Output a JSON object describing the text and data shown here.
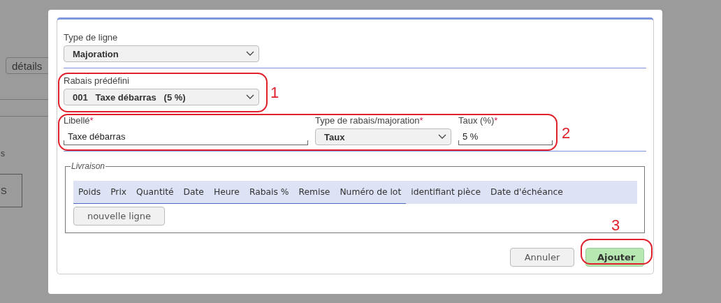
{
  "background": {
    "button": "détails",
    "text_1": "s",
    "text_2": "S"
  },
  "dialog": {
    "line_type": {
      "label": "Type de ligne",
      "value": "Majoration"
    },
    "predefined_discount": {
      "label": "Rabais prédéfini",
      "value": "001   Taxe débarras   (5 %)"
    },
    "fields": [
      {
        "kind": "input",
        "label": "Libellé",
        "required_mark": "*",
        "value": "Taxe débarras"
      },
      {
        "kind": "select",
        "label": "Type de rabais/majoration",
        "required_mark": "*",
        "value": "Taux"
      },
      {
        "kind": "input",
        "label": "Taux (%)",
        "required_mark": "*",
        "value": "5 %"
      }
    ],
    "delivery": {
      "legend": "Livraison",
      "columns": [
        {
          "label": "Poids",
          "underlined": true
        },
        {
          "label": "Prix",
          "underlined": true
        },
        {
          "label": "Quantité",
          "underlined": true
        },
        {
          "label": "Date",
          "underlined": true
        },
        {
          "label": "Heure",
          "underlined": true
        },
        {
          "label": "Rabais %",
          "underlined": true
        },
        {
          "label": "Remise",
          "underlined": true
        },
        {
          "label": "Numéro de lot",
          "underlined": true
        },
        {
          "label": "identifiant pièce",
          "underlined": false
        },
        {
          "label": "Date d'échéance",
          "underlined": false
        }
      ],
      "new_line_button": "nouvelle ligne"
    },
    "buttons": [
      {
        "label": "Annuler",
        "primary": false
      },
      {
        "label": "Ajouter",
        "primary": true
      }
    ]
  },
  "annotations": [
    "1",
    "2",
    "3"
  ]
}
